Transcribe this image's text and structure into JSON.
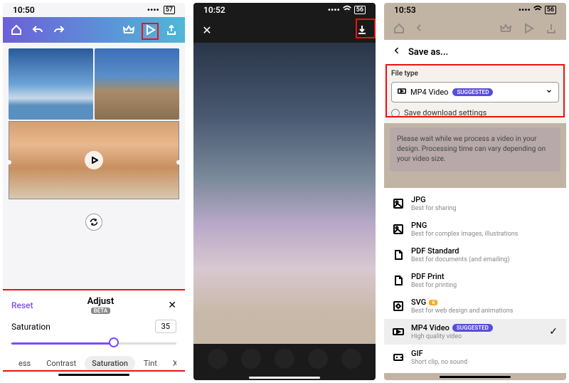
{
  "phone1": {
    "time": "10:50",
    "battery": "57",
    "adjust": {
      "reset": "Reset",
      "title": "Adjust",
      "beta": "BETA",
      "param_label": "Saturation",
      "param_value": "35",
      "slider_pct": 62,
      "tabs": [
        "ess",
        "Contrast",
        "Saturation",
        "Tint",
        "X-Proce"
      ],
      "active_tab": 2
    }
  },
  "phone2": {
    "time": "10:52",
    "battery": "56"
  },
  "phone3": {
    "time": "10:53",
    "battery": "56",
    "saveas": "Save as...",
    "filetype_label": "File type",
    "selected_format": "MP4 Video",
    "suggested": "SUGGESTED",
    "save_dl_label": "Save download settings",
    "notice": "Please wait while we process a video in your design. Processing time can vary depending on your video size.",
    "formats": [
      {
        "name": "JPG",
        "desc": "Best for sharing",
        "badge": null,
        "selected": false
      },
      {
        "name": "PNG",
        "desc": "Best for complex images, illustrations",
        "badge": null,
        "selected": false
      },
      {
        "name": "PDF Standard",
        "desc": "Best for documents (and emailing)",
        "badge": null,
        "selected": false
      },
      {
        "name": "PDF Print",
        "desc": "Best for printing",
        "badge": null,
        "selected": false
      },
      {
        "name": "SVG",
        "desc": "Best for web design and animations",
        "badge": "crown",
        "selected": false
      },
      {
        "name": "MP4 Video",
        "desc": "High quality video",
        "badge": "suggested",
        "selected": true
      },
      {
        "name": "GIF",
        "desc": "Short clip, no sound",
        "badge": null,
        "selected": false
      }
    ]
  }
}
